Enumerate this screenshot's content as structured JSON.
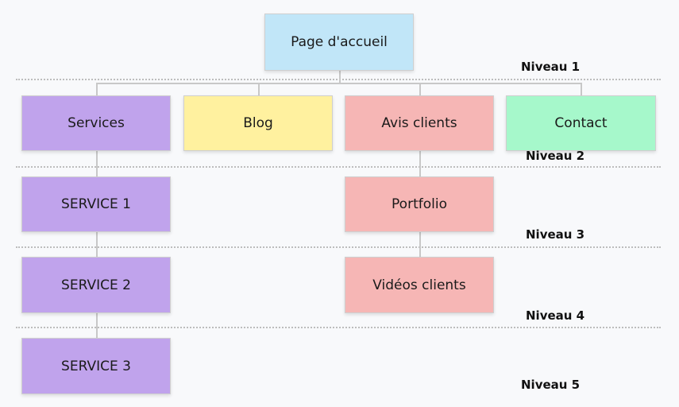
{
  "colors": {
    "level1": "#c1e6f8",
    "services": "#c0a3ec",
    "blog": "#fff19f",
    "avis": "#f6b6b5",
    "contact": "#a6f8cb"
  },
  "nodes": {
    "home": "Page d'accueil",
    "services": "Services",
    "blog": "Blog",
    "avis": "Avis clients",
    "contact": "Contact",
    "service1": "SERVICE 1",
    "service2": "SERVICE 2",
    "service3": "SERVICE 3",
    "portfolio": "Portfolio",
    "videos": "Vidéos clients"
  },
  "levels": [
    "Niveau 1",
    "Niveau 2",
    "Niveau 3",
    "Niveau 4",
    "Niveau 5"
  ]
}
